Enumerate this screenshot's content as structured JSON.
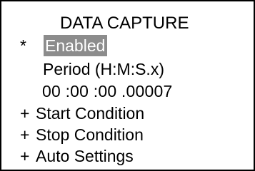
{
  "screen": {
    "title": "DATA CAPTURE",
    "items": [
      {
        "marker": "*",
        "label": "Enabled",
        "selected": true
      },
      {
        "marker": "",
        "label": "Period (H:M:S.x)"
      },
      {
        "marker": "",
        "label": "00 :00 :00 .00007"
      },
      {
        "marker": "+",
        "label": "Start Condition"
      },
      {
        "marker": "+",
        "label": "Stop Condition"
      },
      {
        "marker": "+",
        "label": "Auto Settings"
      }
    ]
  },
  "colors": {
    "background": "#ffffff",
    "text": "#000000",
    "highlight_background": "#8c8c8c",
    "highlight_text": "#ffffff"
  }
}
